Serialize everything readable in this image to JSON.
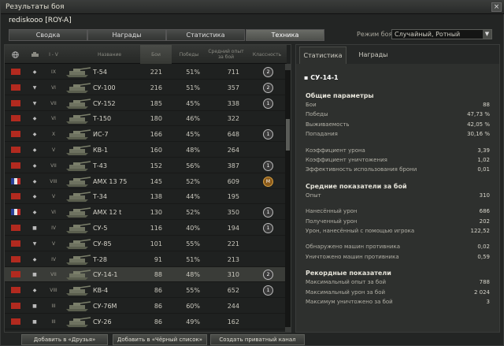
{
  "window": {
    "title": "Результаты боя",
    "close_label": "×"
  },
  "player": {
    "name": "rediskooo [ROY-A]"
  },
  "tabs": [
    "Сводка",
    "Награды",
    "Статистика",
    "Техника"
  ],
  "mode": {
    "label": "Режим боя:",
    "value": "Случайный, Ротный"
  },
  "table": {
    "headers": {
      "nation": "",
      "type": "",
      "tier": "I - V",
      "name": "Название",
      "battles": "Бои",
      "wins": "Победы",
      "avg_xp": "Средний опыт за бой",
      "mastery": "Классность"
    },
    "rows": [
      {
        "nation": "ussr",
        "type": "◆",
        "tier": "IX",
        "name": "Т-54",
        "battles": "221",
        "wins": "51%",
        "xp": "711",
        "badge": "2"
      },
      {
        "nation": "ussr",
        "type": "▼",
        "tier": "VI",
        "name": "СУ-100",
        "battles": "216",
        "wins": "51%",
        "xp": "357",
        "badge": "2"
      },
      {
        "nation": "ussr",
        "type": "▼",
        "tier": "VII",
        "name": "СУ-152",
        "battles": "185",
        "wins": "45%",
        "xp": "338",
        "badge": "1"
      },
      {
        "nation": "ussr",
        "type": "◆",
        "tier": "VI",
        "name": "Т-150",
        "battles": "180",
        "wins": "46%",
        "xp": "322",
        "badge": ""
      },
      {
        "nation": "ussr",
        "type": "◆",
        "tier": "X",
        "name": "ИС-7",
        "battles": "166",
        "wins": "45%",
        "xp": "648",
        "badge": "1"
      },
      {
        "nation": "ussr",
        "type": "◆",
        "tier": "V",
        "name": "КВ-1",
        "battles": "160",
        "wins": "48%",
        "xp": "264",
        "badge": ""
      },
      {
        "nation": "ussr",
        "type": "◆",
        "tier": "VII",
        "name": "Т-43",
        "battles": "152",
        "wins": "56%",
        "xp": "387",
        "badge": "1"
      },
      {
        "nation": "fr",
        "type": "◆",
        "tier": "VIII",
        "name": "AMX 13 75",
        "battles": "145",
        "wins": "52%",
        "xp": "609",
        "badge": "M"
      },
      {
        "nation": "ussr",
        "type": "◆",
        "tier": "V",
        "name": "Т-34",
        "battles": "138",
        "wins": "44%",
        "xp": "195",
        "badge": ""
      },
      {
        "nation": "fr",
        "type": "◆",
        "tier": "VI",
        "name": "AMX 12 t",
        "battles": "130",
        "wins": "52%",
        "xp": "350",
        "badge": "1"
      },
      {
        "nation": "ussr",
        "type": "■",
        "tier": "IV",
        "name": "СУ-5",
        "battles": "116",
        "wins": "40%",
        "xp": "194",
        "badge": "1"
      },
      {
        "nation": "ussr",
        "type": "▼",
        "tier": "V",
        "name": "СУ-85",
        "battles": "101",
        "wins": "55%",
        "xp": "221",
        "badge": ""
      },
      {
        "nation": "ussr",
        "type": "◆",
        "tier": "IV",
        "name": "Т-28",
        "battles": "91",
        "wins": "51%",
        "xp": "213",
        "badge": ""
      },
      {
        "nation": "ussr",
        "type": "■",
        "tier": "VII",
        "name": "СУ-14-1",
        "battles": "88",
        "wins": "48%",
        "xp": "310",
        "badge": "2"
      },
      {
        "nation": "ussr",
        "type": "◆",
        "tier": "VIII",
        "name": "КВ-4",
        "battles": "86",
        "wins": "55%",
        "xp": "652",
        "badge": "1"
      },
      {
        "nation": "ussr",
        "type": "■",
        "tier": "III",
        "name": "СУ-76М",
        "battles": "86",
        "wins": "60%",
        "xp": "244",
        "badge": ""
      },
      {
        "nation": "ussr",
        "type": "■",
        "tier": "III",
        "name": "СУ-26",
        "battles": "86",
        "wins": "49%",
        "xp": "162",
        "badge": ""
      }
    ]
  },
  "right": {
    "tabs": [
      "Статистика",
      "Награды"
    ],
    "vehicle": "СУ-14-1",
    "sections": [
      {
        "title": "Общие параметры",
        "items": [
          {
            "k": "Бои",
            "v": "88"
          },
          {
            "k": "Победы",
            "v": "47,73 %"
          },
          {
            "k": "Выживаемость",
            "v": "42,05 %"
          },
          {
            "k": "Попадания",
            "v": "30,16 %"
          }
        ]
      },
      {
        "title": "",
        "items": [
          {
            "k": "Коэффициент урона",
            "v": "3,39"
          },
          {
            "k": "Коэффициент уничтожения",
            "v": "1,02"
          },
          {
            "k": "Эффективность использования брони",
            "v": "0,01"
          }
        ]
      },
      {
        "title": "Средние показатели за бой",
        "items": [
          {
            "k": "Опыт",
            "v": "310"
          }
        ]
      },
      {
        "title": "",
        "items": [
          {
            "k": "Нанесённый урон",
            "v": "686"
          },
          {
            "k": "Полученный урон",
            "v": "202"
          },
          {
            "k": "Урон, нанесённый с помощью игрока",
            "v": "122,52"
          }
        ]
      },
      {
        "title": "",
        "items": [
          {
            "k": "Обнаружено машин противника",
            "v": "0,02"
          },
          {
            "k": "Уничтожено машин противника",
            "v": "0,59"
          }
        ]
      },
      {
        "title": "Рекордные показатели",
        "items": [
          {
            "k": "Максимальный опыт за бой",
            "v": "788"
          },
          {
            "k": "Максимальный урон за бой",
            "v": "2 024"
          },
          {
            "k": "Максимум уничтожено за бой",
            "v": "3"
          }
        ]
      }
    ]
  },
  "buttons": [
    "Добавить в «Друзья»",
    "Добавить в «Чёрный список»",
    "Создать приватный канал"
  ]
}
